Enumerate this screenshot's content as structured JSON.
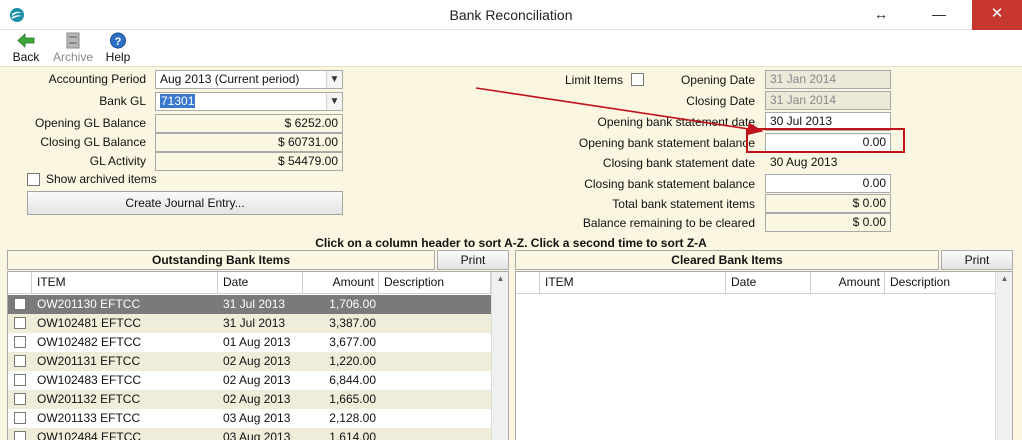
{
  "window": {
    "title": "Bank Reconciliation",
    "restore_glyph": "↔",
    "minimize_glyph": "—",
    "close_glyph": "✕"
  },
  "toolbar": {
    "back": {
      "label": "Back",
      "icon": "back-arrow-icon"
    },
    "archive": {
      "label": "Archive",
      "icon": "archive-icon"
    },
    "help": {
      "label": "Help",
      "icon": "help-icon"
    }
  },
  "left": {
    "accounting_period": {
      "label": "Accounting Period",
      "value": "Aug 2013 (Current period)"
    },
    "bank_gl": {
      "label": "Bank GL",
      "value": "71301"
    },
    "opening_gl_balance": {
      "label": "Opening GL Balance",
      "value": "$ 6252.00"
    },
    "closing_gl_balance": {
      "label": "Closing GL Balance",
      "value": "$ 60731.00"
    },
    "gl_activity": {
      "label": "GL Activity",
      "value": "$ 54479.00"
    },
    "show_archived": {
      "label": "Show archived items",
      "checked": false
    },
    "create_journal": {
      "label": "Create Journal Entry..."
    }
  },
  "right": {
    "limit_items": {
      "label": "Limit Items",
      "checked": false
    },
    "opening_date": {
      "label": "Opening Date",
      "value": "31 Jan 2014"
    },
    "closing_date": {
      "label": "Closing Date",
      "value": "31 Jan 2014"
    },
    "opening_stmt_date": {
      "label": "Opening bank statement date",
      "value": "30 Jul 2013"
    },
    "opening_stmt_balance": {
      "label": "Opening bank statement balance",
      "value": "0.00"
    },
    "closing_stmt_date": {
      "label": "Closing bank statement date",
      "value": "30 Aug 2013"
    },
    "closing_stmt_balance": {
      "label": "Closing bank statement balance",
      "value": "0.00"
    },
    "total_stmt_items": {
      "label": "Total bank statement items",
      "value": "$ 0.00"
    },
    "balance_remaining": {
      "label": "Balance remaining to be cleared",
      "value": "$ 0.00"
    }
  },
  "hint": "Click on a column header to sort A-Z.  Click a second time to sort Z-A",
  "outstanding": {
    "title": "Outstanding Bank Items",
    "print_label": "Print",
    "columns": {
      "item": "ITEM",
      "date": "Date",
      "amount": "Amount",
      "description": "Description"
    },
    "rows": [
      {
        "item": "OW201130 EFTCC",
        "date": "31 Jul 2013",
        "amount": "1,706.00",
        "selected": true
      },
      {
        "item": "OW102481 EFTCC",
        "date": "31 Jul 2013",
        "amount": "3,387.00"
      },
      {
        "item": "OW102482 EFTCC",
        "date": "01 Aug 2013",
        "amount": "3,677.00"
      },
      {
        "item": "OW201131 EFTCC",
        "date": "02 Aug 2013",
        "amount": "1,220.00"
      },
      {
        "item": "OW102483 EFTCC",
        "date": "02 Aug 2013",
        "amount": "6,844.00"
      },
      {
        "item": "OW201132 EFTCC",
        "date": "02 Aug 2013",
        "amount": "1,665.00"
      },
      {
        "item": "OW201133 EFTCC",
        "date": "03 Aug 2013",
        "amount": "2,128.00"
      },
      {
        "item": "OW102484 EFTCC",
        "date": "03 Aug 2013",
        "amount": "1,614.00"
      }
    ]
  },
  "cleared": {
    "title": "Cleared Bank Items",
    "print_label": "Print",
    "columns": {
      "item": "ITEM",
      "date": "Date",
      "amount": "Amount",
      "description": "Description"
    },
    "rows": []
  },
  "annotation": {
    "color": "#c0121b"
  }
}
